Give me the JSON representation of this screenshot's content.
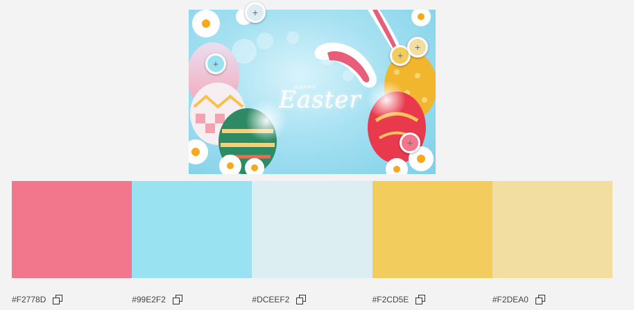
{
  "image": {
    "title_small": "HAPPY",
    "title_large": "Easter"
  },
  "palette": {
    "colors": [
      {
        "hex": "#F2778D",
        "label": "#F2778D"
      },
      {
        "hex": "#99E2F2",
        "label": "#99E2F2"
      },
      {
        "hex": "#DCEEF2",
        "label": "#DCEEF2"
      },
      {
        "hex": "#F2CD5E",
        "label": "#F2CD5E"
      },
      {
        "hex": "#F2DEA0",
        "label": "#F2DEA0"
      }
    ]
  },
  "pickers": [
    {
      "color": "#DCEEF2",
      "icon": "plus-icon"
    },
    {
      "color": "#99E2F2",
      "icon": "plus-icon"
    },
    {
      "color": "#F2CD5E",
      "icon": "plus-icon"
    },
    {
      "color": "#F2DEA0",
      "icon": "plus-icon"
    },
    {
      "color": "#F2778D",
      "icon": "plus-icon"
    }
  ],
  "icons": {
    "picker": "plus",
    "copy": "copy-icon"
  }
}
